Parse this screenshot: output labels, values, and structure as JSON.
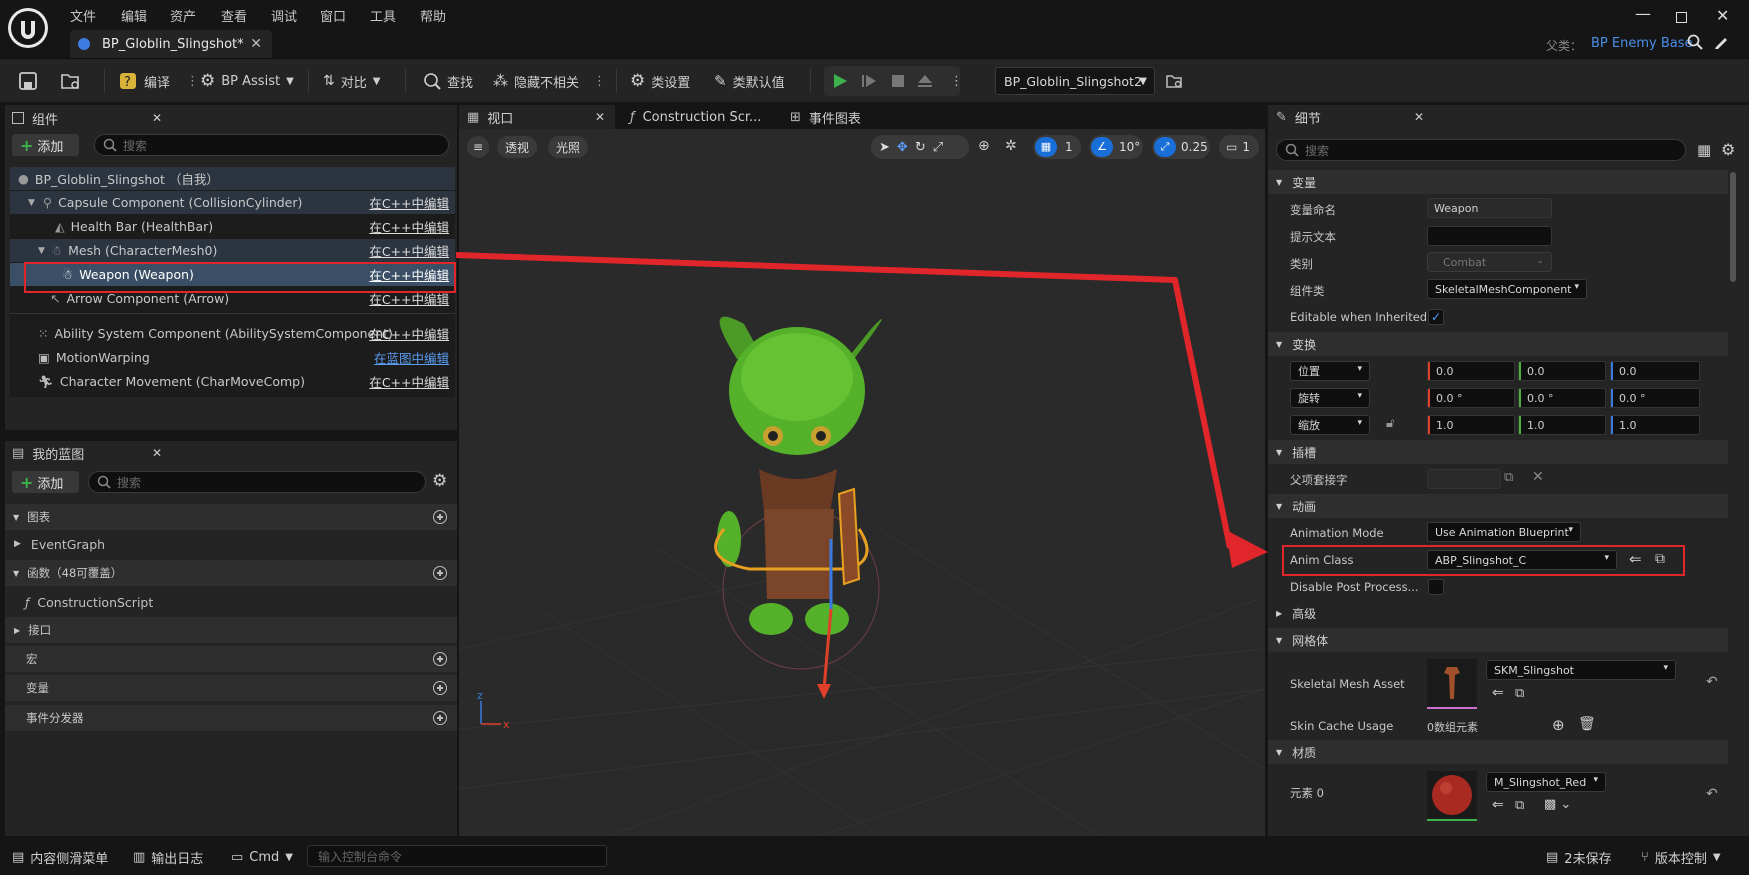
{
  "menu": [
    "文件",
    "编辑",
    "资产",
    "查看",
    "调试",
    "窗口",
    "工具",
    "帮助"
  ],
  "doc_tab": {
    "label": "BP_Globlin_Slingshot*"
  },
  "parent": {
    "label": "父类：",
    "value": "BP Enemy Base"
  },
  "toolbar": {
    "compile": "编译",
    "bp_assist": "BP Assist",
    "diff": "对比",
    "find": "查找",
    "hide_unrelated": "隐藏不相关",
    "class_settings": "类设置",
    "class_defaults": "类默认值",
    "debug_object": "BP_Globlin_Slingshot2"
  },
  "components": {
    "title": "组件",
    "add": "添加",
    "search_placeholder": "搜索",
    "root": "BP_Globlin_Slingshot （自我）",
    "items": [
      {
        "label": "Capsule Component (CollisionCylinder)",
        "edit": "在C++中编辑"
      },
      {
        "label": "Health Bar (HealthBar)",
        "edit": "在C++中编辑"
      },
      {
        "label": "Mesh (CharacterMesh0)",
        "edit": "在C++中编辑"
      },
      {
        "label": "Weapon (Weapon)",
        "edit": "在C++中编辑"
      },
      {
        "label": "Arrow Component (Arrow)",
        "edit": "在C++中编辑"
      },
      {
        "label": "Ability System Component (AbilitySystemComponent)",
        "edit": "在C++中编辑"
      },
      {
        "label": "MotionWarping",
        "edit": "在蓝图中编辑"
      },
      {
        "label": "Character Movement (CharMoveComp)",
        "edit": "在C++中编辑"
      }
    ]
  },
  "my_blueprint": {
    "title": "我的蓝图",
    "add": "添加",
    "search_placeholder": "搜索",
    "graphs": "图表",
    "event_graph": "EventGraph",
    "functions": "函数（48可覆盖）",
    "construction_script": "ConstructionScript",
    "interfaces": "接口",
    "macros": "宏",
    "variables": "变量",
    "dispatchers": "事件分发器"
  },
  "editor_tabs": {
    "viewport": "视口",
    "construction": "Construction Scr...",
    "event_graph": "事件图表"
  },
  "viewport": {
    "perspective": "透视",
    "lighting": "光照",
    "grid_value": "1",
    "angle_value": "10°",
    "scale_value": "0.25",
    "camera_value": "1"
  },
  "details": {
    "title": "细节",
    "search_placeholder": "搜索",
    "sec_variable": "变量",
    "var_name_label": "变量命名",
    "var_name": "Weapon",
    "tooltip_label": "提示文本",
    "tooltip": "",
    "category_label": "类别",
    "category": "Combat",
    "comp_class_label": "组件类",
    "comp_class": "SkeletalMeshComponent",
    "editable_label": "Editable when Inherited",
    "sec_transform": "变换",
    "location": "位置",
    "rotation": "旋转",
    "scale": "缩放",
    "loc": [
      "0.0",
      "0.0",
      "0.0"
    ],
    "rot": [
      "0.0 °",
      "0.0 °",
      "0.0 °"
    ],
    "scl": [
      "1.0",
      "1.0",
      "1.0"
    ],
    "sec_socket": "插槽",
    "parent_socket": "父项套接字",
    "sec_anim": "动画",
    "anim_mode_label": "Animation Mode",
    "anim_mode": "Use Animation Blueprint",
    "anim_class_label": "Anim Class",
    "anim_class": "ABP_Slingshot_C",
    "disable_pp": "Disable Post Process...",
    "advanced": "高级",
    "sec_mesh": "网格体",
    "skel_mesh_label": "Skeletal Mesh Asset",
    "skel_mesh": "SKM_Slingshot",
    "skin_cache_label": "Skin Cache Usage",
    "skin_cache": "0数组元素",
    "sec_material": "材质",
    "element0": "元素 0",
    "material": "M_Slingshot_Red"
  },
  "bottom": {
    "content_drawer": "内容侧滑菜单",
    "output_log": "输出日志",
    "cmd": "Cmd",
    "console_placeholder": "输入控制台命令",
    "unsaved": "2未保存",
    "source_control": "版本控制"
  },
  "colors": {
    "accent": "#1a6ed8",
    "highlight_red": "#e0262b",
    "selected_row": "#3a4f66"
  }
}
